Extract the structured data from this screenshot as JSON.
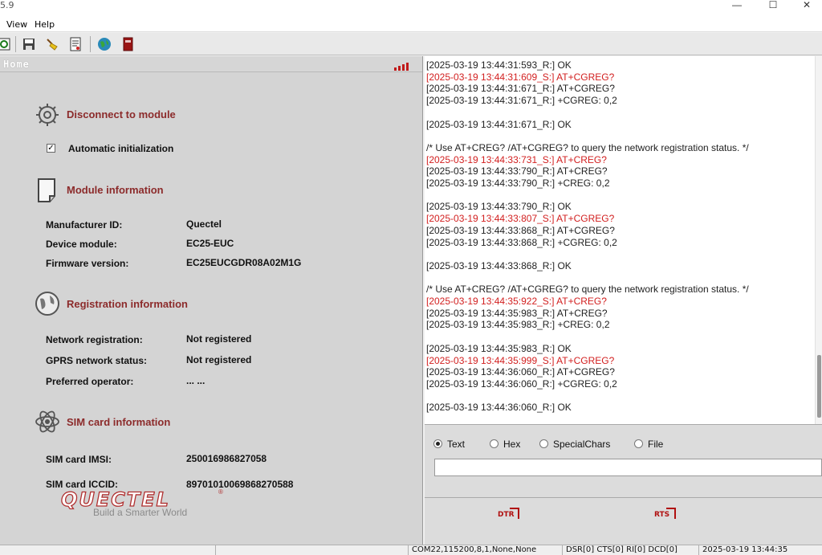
{
  "window": {
    "title_fragment": "5.9",
    "minimize_glyph": "—",
    "maximize_glyph": "☐",
    "close_glyph": "✕"
  },
  "menu": {
    "items": [
      "View",
      "Help"
    ]
  },
  "toolbar": {
    "icons": [
      "refresh-icon",
      "save-icon",
      "clear-brush-icon",
      "script-icon",
      "globe-icon",
      "book-icon"
    ]
  },
  "home": {
    "label": "Home",
    "signal_icon": "signal-bars-icon"
  },
  "sections": {
    "connect": {
      "title": "Disconnect to module",
      "icon": "gear-icon",
      "auto_init_label": "Automatic initialization",
      "auto_init_checked": true,
      "check_glyph": "✓"
    },
    "module": {
      "title": "Module information",
      "icon": "document-icon",
      "rows": [
        {
          "label": "Manufacturer ID:",
          "value": "Quectel"
        },
        {
          "label": "Device module:",
          "value": "EC25-EUC"
        },
        {
          "label": "Firmware version:",
          "value": "EC25EUCGDR08A02M1G"
        }
      ]
    },
    "registration": {
      "title": "Registration information",
      "icon": "globe-icon",
      "rows": [
        {
          "label": "Network registration:",
          "value": "Not registered"
        },
        {
          "label": "GPRS network status:",
          "value": "Not registered"
        },
        {
          "label": "Preferred operator:",
          "value": "... ..."
        }
      ]
    },
    "sim": {
      "title": "SIM card information",
      "icon": "atom-icon",
      "rows": [
        {
          "label": "SIM card IMSI:",
          "value": "250016986827058"
        },
        {
          "label": "SIM card ICCID:",
          "value": "89701010069868270588"
        }
      ]
    }
  },
  "logo": {
    "brand": "QUECTEL",
    "registered": "®",
    "tagline": "Build a Smarter World",
    "brand_color": "#b03030"
  },
  "log": {
    "lines": [
      {
        "text": "[2025-03-19 13:44:31:593_R:] OK",
        "sent": false
      },
      {
        "text": "[2025-03-19 13:44:31:609_S:] AT+CGREG?",
        "sent": true
      },
      {
        "text": "[2025-03-19 13:44:31:671_R:] AT+CGREG?",
        "sent": false
      },
      {
        "text": "[2025-03-19 13:44:31:671_R:] +CGREG: 0,2",
        "sent": false
      },
      {
        "text": "",
        "sent": false
      },
      {
        "text": "[2025-03-19 13:44:31:671_R:] OK",
        "sent": false
      },
      {
        "text": "",
        "sent": false
      },
      {
        "text": "/* Use AT+CREG? /AT+CGREG? to query the network registration status. */",
        "sent": false
      },
      {
        "text": "[2025-03-19 13:44:33:731_S:] AT+CREG?",
        "sent": true
      },
      {
        "text": "[2025-03-19 13:44:33:790_R:] AT+CREG?",
        "sent": false
      },
      {
        "text": "[2025-03-19 13:44:33:790_R:] +CREG: 0,2",
        "sent": false
      },
      {
        "text": "",
        "sent": false
      },
      {
        "text": "[2025-03-19 13:44:33:790_R:] OK",
        "sent": false
      },
      {
        "text": "[2025-03-19 13:44:33:807_S:] AT+CGREG?",
        "sent": true
      },
      {
        "text": "[2025-03-19 13:44:33:868_R:] AT+CGREG?",
        "sent": false
      },
      {
        "text": "[2025-03-19 13:44:33:868_R:] +CGREG: 0,2",
        "sent": false
      },
      {
        "text": "",
        "sent": false
      },
      {
        "text": "[2025-03-19 13:44:33:868_R:] OK",
        "sent": false
      },
      {
        "text": "",
        "sent": false
      },
      {
        "text": "/* Use AT+CREG? /AT+CGREG? to query the network registration status. */",
        "sent": false
      },
      {
        "text": "[2025-03-19 13:44:35:922_S:] AT+CREG?",
        "sent": true
      },
      {
        "text": "[2025-03-19 13:44:35:983_R:] AT+CREG?",
        "sent": false
      },
      {
        "text": "[2025-03-19 13:44:35:983_R:] +CREG: 0,2",
        "sent": false
      },
      {
        "text": "",
        "sent": false
      },
      {
        "text": "[2025-03-19 13:44:35:983_R:] OK",
        "sent": false
      },
      {
        "text": "[2025-03-19 13:44:35:999_S:] AT+CGREG?",
        "sent": true
      },
      {
        "text": "[2025-03-19 13:44:36:060_R:] AT+CGREG?",
        "sent": false
      },
      {
        "text": "[2025-03-19 13:44:36:060_R:] +CGREG: 0,2",
        "sent": false
      },
      {
        "text": "",
        "sent": false
      },
      {
        "text": "[2025-03-19 13:44:36:060_R:] OK",
        "sent": false
      }
    ],
    "sent_color": "#d21f1f",
    "received_color": "#222222"
  },
  "send": {
    "modes": [
      {
        "label": "Text",
        "selected": true
      },
      {
        "label": "Hex",
        "selected": false
      },
      {
        "label": "SpecialChars",
        "selected": false
      },
      {
        "label": "File",
        "selected": false
      }
    ],
    "input_value": "",
    "dtr_label": "DTR",
    "rts_label": "RTS"
  },
  "status": {
    "port": "COM22,115200,8,1,None,None",
    "signals": "DSR[0] CTS[0] RI[0] DCD[0]",
    "datetime": "2025-03-19 13:44:35"
  }
}
